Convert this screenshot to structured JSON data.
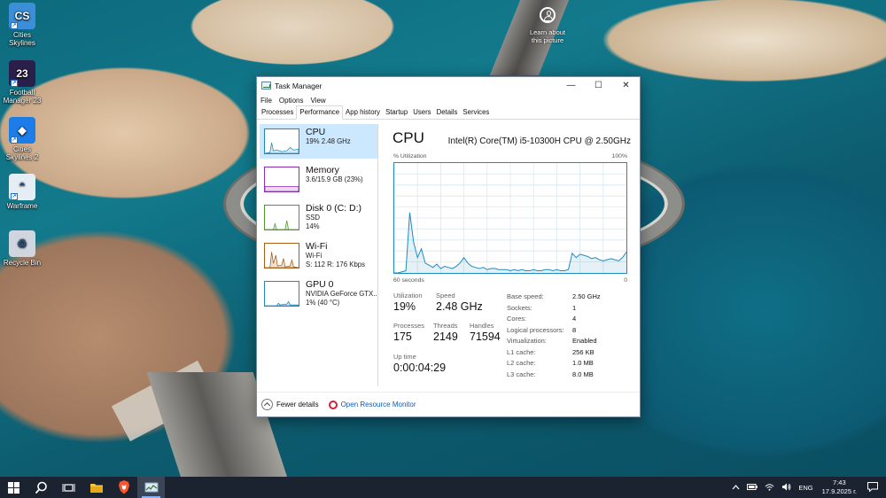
{
  "desktop": {
    "icons": [
      {
        "label": "Cities Skylines",
        "glyph": "CS",
        "color": "#3a8fd8"
      },
      {
        "label": "Football Manager 23",
        "glyph": "23",
        "color": "#2a1f4a"
      },
      {
        "label": "Cities Skylines 2",
        "glyph": "◆",
        "color": "#1d7de8"
      },
      {
        "label": "Warframe",
        "glyph": "⌃",
        "color": "#e6eef5"
      },
      {
        "label": "Recycle Bin",
        "glyph": "♻",
        "color": "#cfd6df"
      }
    ],
    "learn_label": "Learn about this picture"
  },
  "window": {
    "title": "Task Manager",
    "controls": {
      "minimize": "—",
      "maximize": "☐",
      "close": "✕"
    },
    "menu": [
      "File",
      "Options",
      "View"
    ],
    "tabs": [
      "Processes",
      "Performance",
      "App history",
      "Startup",
      "Users",
      "Details",
      "Services"
    ],
    "active_tab": "Performance"
  },
  "sidebar": {
    "items": [
      {
        "title": "CPU",
        "sub1": "19% 2.48 GHz",
        "sub2": "",
        "sub3": "",
        "color": "#1f8ac0",
        "active": true
      },
      {
        "title": "Memory",
        "sub1": "3.6/15.9 GB (23%)",
        "sub2": "",
        "sub3": "",
        "color": "#8b2fb0",
        "active": false
      },
      {
        "title": "Disk 0 (C: D:)",
        "sub1": "SSD",
        "sub2": "14%",
        "sub3": "",
        "color": "#4d9a2a",
        "active": false
      },
      {
        "title": "Wi-Fi",
        "sub1": "Wi-Fi",
        "sub2": "S: 112 R: 176 Kbps",
        "sub3": "",
        "color": "#a75d18",
        "active": false
      },
      {
        "title": "GPU 0",
        "sub1": "NVIDIA GeForce GTX...",
        "sub2": "1% (40 °C)",
        "sub3": "",
        "color": "#1f8ac0",
        "active": false
      }
    ]
  },
  "cpu": {
    "title": "CPU",
    "model": "Intel(R) Core(TM) i5-10300H CPU @ 2.50GHz",
    "graph_top_left": "% Utilization",
    "graph_top_right": "100%",
    "graph_bottom_left": "60 seconds",
    "graph_bottom_right": "0",
    "utilization_series": [
      0,
      0,
      1,
      2,
      55,
      28,
      14,
      22,
      9,
      7,
      5,
      8,
      4,
      6,
      5,
      4,
      6,
      9,
      14,
      9,
      6,
      5,
      4,
      5,
      3,
      4,
      4,
      3,
      3,
      3,
      2,
      3,
      2,
      3,
      2,
      2,
      3,
      2,
      2,
      3,
      3,
      2,
      3,
      2,
      2,
      3,
      18,
      14,
      17,
      16,
      15,
      13,
      14,
      12,
      11,
      12,
      13,
      12,
      11,
      14,
      19
    ],
    "graph_color": "#1f8ac0",
    "stats": {
      "utilization_label": "Utilization",
      "utilization_value": "19%",
      "speed_label": "Speed",
      "speed_value": "2.48 GHz",
      "processes_label": "Processes",
      "processes_value": "175",
      "threads_label": "Threads",
      "threads_value": "2149",
      "handles_label": "Handles",
      "handles_value": "71594",
      "uptime_label": "Up time",
      "uptime_value": "0:00:04:29"
    },
    "properties": [
      {
        "key": "Base speed:",
        "value": "2.50 GHz"
      },
      {
        "key": "Sockets:",
        "value": "1"
      },
      {
        "key": "Cores:",
        "value": "4"
      },
      {
        "key": "Logical processors:",
        "value": "8"
      },
      {
        "key": "Virtualization:",
        "value": "Enabled"
      },
      {
        "key": "L1 cache:",
        "value": "256 KB"
      },
      {
        "key": "L2 cache:",
        "value": "1.0 MB"
      },
      {
        "key": "L3 cache:",
        "value": "8.0 MB"
      }
    ]
  },
  "footer": {
    "fewer_details": "Fewer details",
    "open_resource_monitor": "Open Resource Monitor"
  },
  "taskbar": {
    "apps": [
      "start-icon",
      "search-icon",
      "task-view-icon",
      "file-explorer-icon",
      "brave-icon",
      "task-manager-icon"
    ],
    "language": "ENG",
    "time": "7:43",
    "date": "17.9.2025 г."
  }
}
